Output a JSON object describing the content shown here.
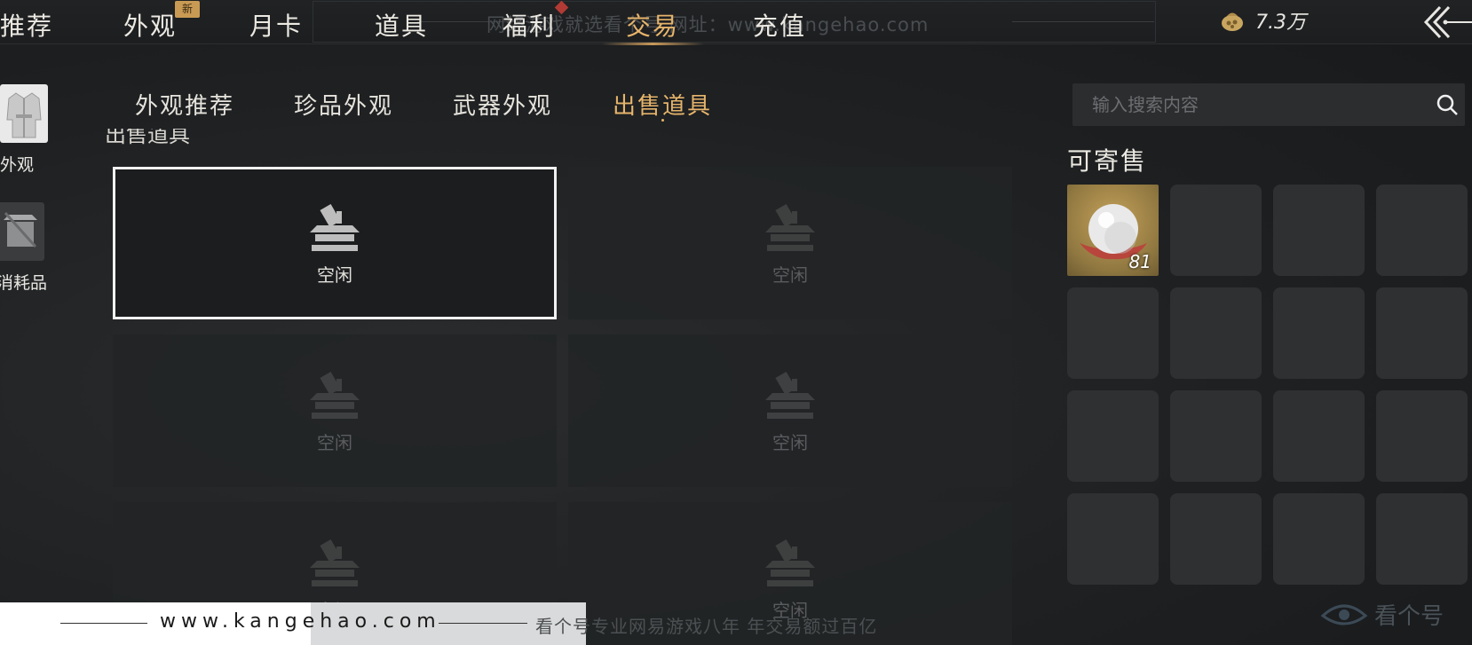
{
  "top_nav": {
    "tabs": [
      {
        "label": "推荐",
        "active": false
      },
      {
        "label": "外观",
        "active": false,
        "badge": "新"
      },
      {
        "label": "月卡",
        "active": false
      },
      {
        "label": "道具",
        "active": false
      },
      {
        "label": "福利",
        "active": false
      },
      {
        "label": "交易",
        "active": true
      },
      {
        "label": "充值",
        "active": false
      }
    ],
    "watermark": "网络游戏就选看个号 网址：www.kangehao.com",
    "currency": {
      "icon": "coin-pouch-icon",
      "value": "7.3万"
    },
    "back_icon": "double-chevron-left-icon"
  },
  "sidebar": {
    "items": [
      {
        "label": "外观",
        "icon": "robe-icon",
        "active": true
      },
      {
        "label": "消耗品",
        "icon": "consumable-icon",
        "active": false
      }
    ]
  },
  "sub_tabs": {
    "items": [
      {
        "label": "外观推荐",
        "active": false
      },
      {
        "label": "珍品外观",
        "active": false
      },
      {
        "label": "武器外观",
        "active": false
      },
      {
        "label": "出售道具",
        "active": true
      }
    ],
    "cut_off_heading": "出售道具"
  },
  "slots": [
    {
      "label": "空闲",
      "selected": true,
      "icon": "stall-icon"
    },
    {
      "label": "空闲",
      "selected": false,
      "icon": "stall-icon"
    },
    {
      "label": "空闲",
      "selected": false,
      "icon": "stall-icon"
    },
    {
      "label": "空闲",
      "selected": false,
      "icon": "stall-icon"
    },
    {
      "label": "空闲",
      "selected": false,
      "icon": "stall-icon"
    },
    {
      "label": "空闲",
      "selected": false,
      "icon": "stall-icon"
    }
  ],
  "right_panel": {
    "search_placeholder": "输入搜索内容",
    "title": "可寄售",
    "items": [
      {
        "icon": "pearl-icon",
        "quantity": "81"
      }
    ],
    "empty_cells": 15
  },
  "bottom_bar": {
    "url": "www.kangehao.com",
    "slogan": "看个号专业网易游戏八年 年交易额过百亿",
    "logo_text": "看个号"
  },
  "colors": {
    "accent_gold": "#e6b46b",
    "background": "#1e2022",
    "badge": "#c99a54",
    "marker_red": "#b23a34"
  }
}
